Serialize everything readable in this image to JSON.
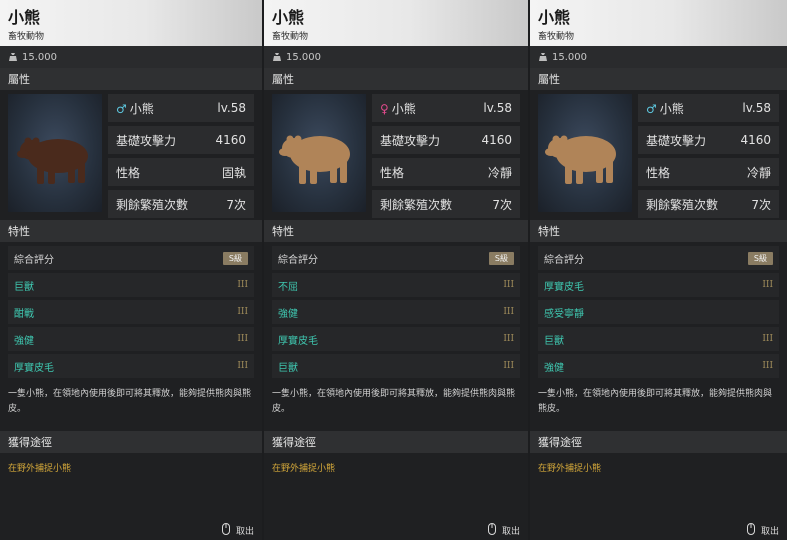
{
  "panels": [
    {
      "title": "小熊",
      "category": "畜牧動物",
      "price": "15.000",
      "sections": {
        "attr": "屬性",
        "trait": "特性",
        "obtain": "獲得途徑"
      },
      "gender_icon": "male-icon",
      "gender_color": "#5ec8e0",
      "stats": {
        "name": "小熊",
        "level": "lv.58",
        "atk_label": "基礎攻擊力",
        "atk": "4160",
        "nature_label": "性格",
        "nature": "固執",
        "breed_label": "剩餘繁殖次數",
        "breed": "7次"
      },
      "bear_color": "#4a2a1c",
      "score_label": "綜合評分",
      "score": "S級",
      "traits": [
        {
          "name": "巨獸",
          "level": "III"
        },
        {
          "name": "酣戰",
          "level": "III"
        },
        {
          "name": "強健",
          "level": "III"
        },
        {
          "name": "厚實皮毛",
          "level": "III"
        }
      ],
      "description": "一隻小熊，在領地內使用後即可將其釋放，能夠提供熊肉與熊皮。",
      "obtain_text": "在野外捕捉小熊",
      "exit": "取出"
    },
    {
      "title": "小熊",
      "category": "畜牧動物",
      "price": "15.000",
      "sections": {
        "attr": "屬性",
        "trait": "特性",
        "obtain": "獲得途徑"
      },
      "gender_icon": "female-icon",
      "gender_color": "#e04a8c",
      "stats": {
        "name": "小熊",
        "level": "lv.58",
        "atk_label": "基礎攻擊力",
        "atk": "4160",
        "nature_label": "性格",
        "nature": "冷靜",
        "breed_label": "剩餘繁殖次數",
        "breed": "7次"
      },
      "bear_color": "#b08458",
      "score_label": "綜合評分",
      "score": "S級",
      "traits": [
        {
          "name": "不屈",
          "level": "III"
        },
        {
          "name": "強健",
          "level": "III"
        },
        {
          "name": "厚實皮毛",
          "level": "III"
        },
        {
          "name": "巨獸",
          "level": "III"
        }
      ],
      "description": "一隻小熊，在領地內使用後即可將其釋放，能夠提供熊肉與熊皮。",
      "obtain_text": "在野外捕捉小熊",
      "exit": "取出"
    },
    {
      "title": "小熊",
      "category": "畜牧動物",
      "price": "15.000",
      "sections": {
        "attr": "屬性",
        "trait": "特性",
        "obtain": "獲得途徑"
      },
      "gender_icon": "male-icon",
      "gender_color": "#5ec8e0",
      "stats": {
        "name": "小熊",
        "level": "lv.58",
        "atk_label": "基礎攻擊力",
        "atk": "4160",
        "nature_label": "性格",
        "nature": "冷靜",
        "breed_label": "剩餘繁殖次數",
        "breed": "7次"
      },
      "bear_color": "#b08458",
      "score_label": "綜合評分",
      "score": "S級",
      "traits": [
        {
          "name": "厚實皮毛",
          "level": "III"
        },
        {
          "name": "感受寧靜",
          "level": ""
        },
        {
          "name": "巨獸",
          "level": "III"
        },
        {
          "name": "強健",
          "level": "III"
        }
      ],
      "description": "一隻小熊，在領地內使用後即可將其釋放，能夠提供熊肉與熊皮。",
      "obtain_text": "在野外捕捉小熊",
      "exit": "取出"
    }
  ]
}
